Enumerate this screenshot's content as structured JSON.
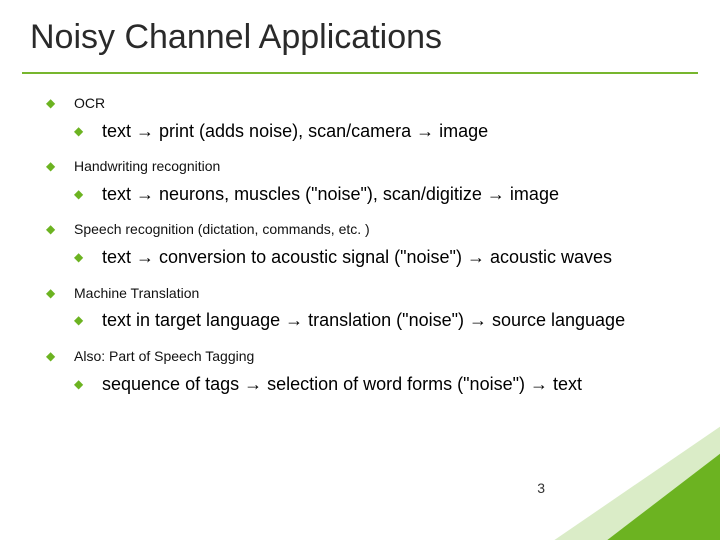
{
  "title": "Noisy Channel Applications",
  "items": [
    {
      "label": "OCR",
      "sub": "text → print (adds noise), scan/camera → image"
    },
    {
      "label": "Handwriting recognition",
      "sub": "text → neurons, muscles (\"noise\"), scan/digitize → image"
    },
    {
      "label": "Speech recognition (dictation, commands, etc. )",
      "sub": "text → conversion to acoustic signal (\"noise\") → acoustic waves"
    },
    {
      "label": "Machine Translation",
      "sub": "text in target language → translation (\"noise\") → source language"
    },
    {
      "label": "Also: Part of Speech Tagging",
      "sub": "sequence of tags → selection of word forms (\"noise\") → text"
    }
  ],
  "page_number": "3"
}
